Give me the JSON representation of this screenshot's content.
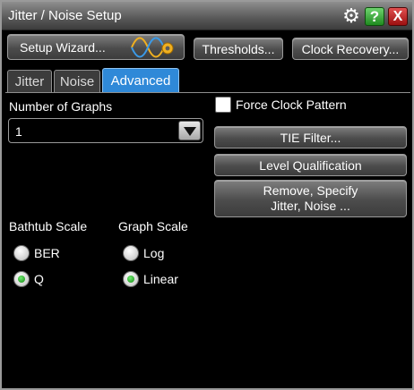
{
  "window": {
    "title": "Jitter / Noise Setup"
  },
  "titlebar_icons": {
    "settings": "gear-icon",
    "help": "?",
    "close": "X"
  },
  "toolbar": {
    "setup_wizard": "Setup Wizard...",
    "thresholds": "Thresholds...",
    "clock_recovery": "Clock Recovery..."
  },
  "tabs": [
    {
      "label": "Jitter",
      "active": false
    },
    {
      "label": "Noise",
      "active": false
    },
    {
      "label": "Advanced",
      "active": true
    }
  ],
  "advanced": {
    "num_graphs_label": "Number of Graphs",
    "num_graphs_value": "1",
    "force_clock_label": "Force Clock Pattern",
    "force_clock_checked": false,
    "tie_filter": "TIE Filter...",
    "level_qualification": "Level Qualification",
    "remove_specify_line1": "Remove, Specify",
    "remove_specify_line2": "Jitter, Noise ...",
    "bathtub_scale": {
      "label": "Bathtub Scale",
      "options": [
        {
          "label": "BER",
          "checked": false
        },
        {
          "label": "Q",
          "checked": true
        }
      ]
    },
    "graph_scale": {
      "label": "Graph Scale",
      "options": [
        {
          "label": "Log",
          "checked": false
        },
        {
          "label": "Linear",
          "checked": true
        }
      ]
    }
  },
  "colors": {
    "active_tab": "#2f89d8",
    "radio_selected": "#1fa01f",
    "help_button": "#2a9a2a",
    "close_button": "#b01818"
  }
}
